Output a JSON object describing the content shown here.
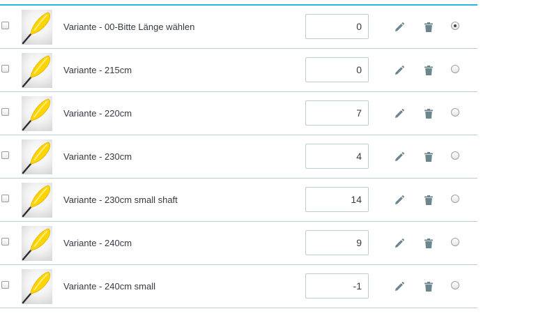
{
  "variants": [
    {
      "name": "Variante - 00-Bitte Länge wählen",
      "quantity": "0",
      "default": true
    },
    {
      "name": "Variante - 215cm",
      "quantity": "0",
      "default": false
    },
    {
      "name": "Variante - 220cm",
      "quantity": "7",
      "default": false
    },
    {
      "name": "Variante - 230cm",
      "quantity": "4",
      "default": false
    },
    {
      "name": "Variante - 230cm small shaft",
      "quantity": "14",
      "default": false
    },
    {
      "name": "Variante - 240cm",
      "quantity": "9",
      "default": false
    },
    {
      "name": "Variante - 240cm small",
      "quantity": "-1",
      "default": false
    }
  ],
  "icons": {
    "edit": "pencil-icon",
    "delete": "trash-icon",
    "thumbnail": "paddle-thumbnail"
  },
  "colors": {
    "header_accent": "#25b9d7",
    "row_border": "#bbcdd2",
    "icon": "#6c868e",
    "text": "#363a41",
    "paddle_yellow": "#ffd500"
  }
}
